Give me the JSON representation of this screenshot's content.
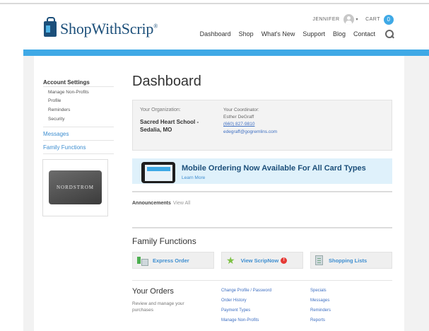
{
  "header": {
    "brand": "ShopWithScrip",
    "brand_mark": "®",
    "username": "JENNIFER",
    "cart_label": "CART",
    "cart_count": "0",
    "nav": [
      "Dashboard",
      "Shop",
      "What's New",
      "Support",
      "Blog",
      "Contact"
    ]
  },
  "sidebar": {
    "account_settings": "Account Settings",
    "sub_items": [
      "Manage Non-Profits",
      "Profile",
      "Reminders",
      "Security"
    ],
    "messages": "Messages",
    "family_functions": "Family Functions",
    "giftcard_brand": "NORDSTROM"
  },
  "main": {
    "title": "Dashboard",
    "org_label": "Your Organization:",
    "org_name": "Sacred Heart School - Sedalia, MO",
    "coord_label": "Your Coordinator:",
    "coord_name": "Esther DeGraff",
    "coord_phone": "(660) 827-9810",
    "coord_email": "edegraff@gogremlins.com",
    "banner_title": "Mobile Ordering Now Available For All Card Types",
    "banner_link": "Learn More",
    "announcements": "Announcements",
    "view_all": "View All",
    "ff_title": "Family Functions",
    "ff_buttons": [
      "Express Order",
      "View ScripNow",
      "Shopping Lists"
    ],
    "alert_badge": "!",
    "orders_title": "Your Orders",
    "orders_desc": "Review and manage your purchases",
    "order_links_col1": [
      "Change Profile / Password",
      "Order History",
      "Payment Types",
      "Manage Non-Profits"
    ],
    "order_links_col2": [
      "Specials",
      "Messages",
      "Reminders",
      "Reports"
    ]
  },
  "colors": {
    "accent": "#3fa9e6",
    "brand": "#1c4f7a",
    "link": "#3e8ed0"
  }
}
